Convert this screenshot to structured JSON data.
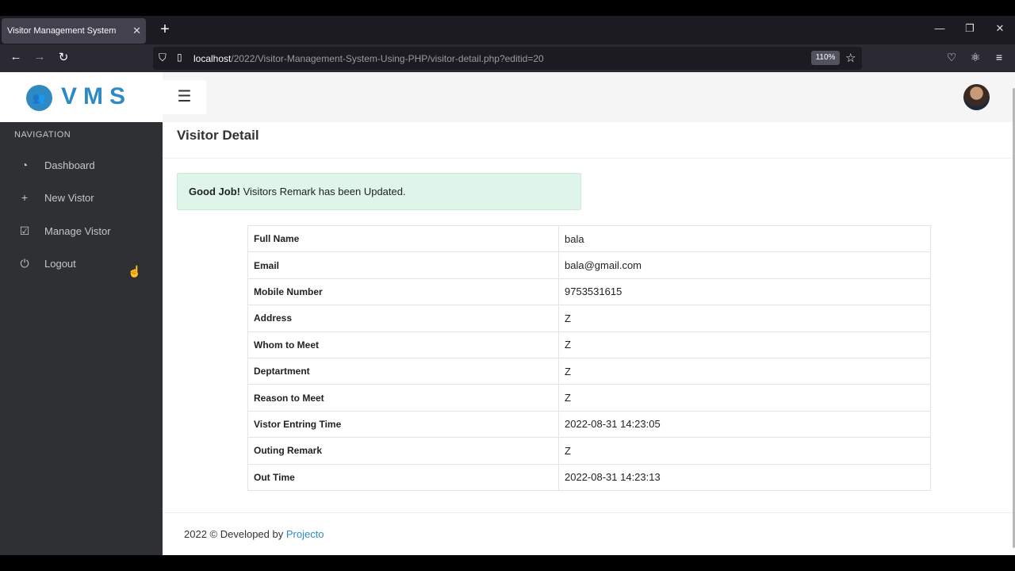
{
  "browser": {
    "tab_title": "Visitor Management System",
    "tab_close": "✕",
    "new_tab": "+",
    "url_host": "localhost",
    "url_path": "/2022/Visitor-Management-System-Using-PHP/visitor-detail.php?editid=20",
    "zoom": "110%"
  },
  "brand": {
    "logo_text": "VMS"
  },
  "sidebar": {
    "title": "NAVIGATION",
    "items": [
      {
        "label": "Dashboard",
        "icon": "speedometer-icon"
      },
      {
        "label": "New Vistor",
        "icon": "plus-icon"
      },
      {
        "label": "Manage Vistor",
        "icon": "edit-square-icon"
      },
      {
        "label": "Logout",
        "icon": "power-icon"
      }
    ]
  },
  "main": {
    "page_title": "Visitor Detail",
    "alert": {
      "strong": "Good Job!",
      "text": " Visitors Remark has been Updated."
    },
    "rows": [
      {
        "label": "Full Name",
        "value": "bala"
      },
      {
        "label": "Email",
        "value": "bala@gmail.com"
      },
      {
        "label": "Mobile Number",
        "value": "9753531615"
      },
      {
        "label": "Address",
        "value": "Z"
      },
      {
        "label": "Whom to Meet",
        "value": "Z"
      },
      {
        "label": "Deptartment",
        "value": "Z"
      },
      {
        "label": "Reason to Meet",
        "value": "Z"
      },
      {
        "label": "Vistor Entring Time",
        "value": "2022-08-31 14:23:05"
      },
      {
        "label": "Outing Remark",
        "value": "Z"
      },
      {
        "label": "Out Time",
        "value": "2022-08-31 14:23:13"
      }
    ]
  },
  "footer": {
    "text": "2022 © Developed by ",
    "link": "Projecto"
  },
  "colors": {
    "sidebar_bg": "#2f3034",
    "brand": "#2f8ac3",
    "alert_bg": "#dff5ea"
  }
}
